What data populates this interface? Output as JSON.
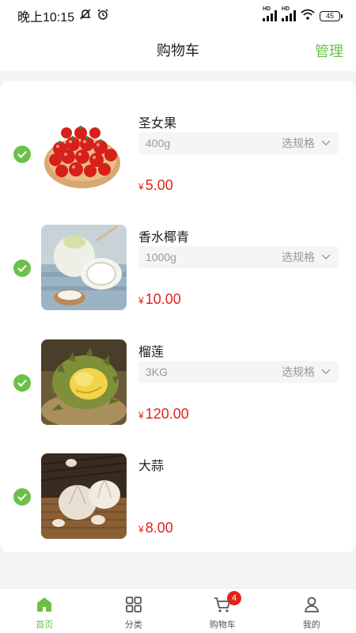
{
  "status": {
    "time": "晚上10:15",
    "battery": "45"
  },
  "header": {
    "title": "购物车",
    "manage_label": "管理"
  },
  "cart": {
    "currency": "¥",
    "spec_action": "选规格",
    "items": [
      {
        "name": "圣女果",
        "spec": "400g",
        "price": "5.00",
        "checked": true,
        "image": "cherry-tomatoes"
      },
      {
        "name": "香水椰青",
        "spec": "1000g",
        "price": "10.00",
        "checked": true,
        "image": "coconut"
      },
      {
        "name": "榴莲",
        "spec": "3KG",
        "price": "120.00",
        "checked": true,
        "image": "durian"
      },
      {
        "name": "大蒜",
        "spec": "",
        "price": "8.00",
        "checked": true,
        "image": "garlic"
      }
    ]
  },
  "tabbar": {
    "tabs": [
      {
        "label": "首页",
        "icon": "home-icon",
        "active": true
      },
      {
        "label": "分类",
        "icon": "category-icon",
        "active": false
      },
      {
        "label": "购物车",
        "icon": "cart-icon",
        "active": false
      },
      {
        "label": "我的",
        "icon": "user-icon",
        "active": false
      }
    ],
    "cart_badge": "4"
  },
  "colors": {
    "accent": "#6cc04a",
    "price": "#e2231a",
    "badge": "#e2231a"
  }
}
